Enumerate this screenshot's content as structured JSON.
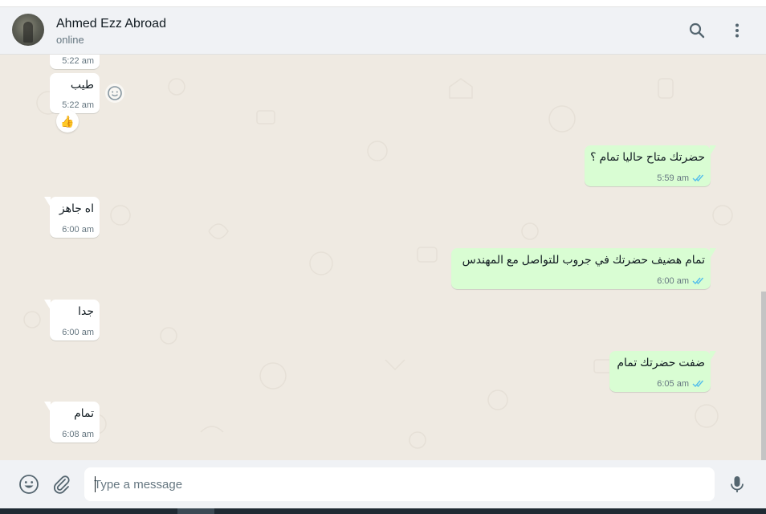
{
  "header": {
    "contact_name": "Ahmed Ezz Abroad",
    "status": "online",
    "icons": [
      "search-icon",
      "menu-dots-icon"
    ]
  },
  "messages": [
    {
      "dir": "in",
      "text": "",
      "time": "5:22 am"
    },
    {
      "dir": "in",
      "text": "طيب",
      "time": "5:22 am",
      "reaction": "👍"
    },
    {
      "dir": "out",
      "text": "حضرتك متاح حاليا تمام ؟",
      "time": "5:59 am",
      "status": "read"
    },
    {
      "dir": "in",
      "text": "اه جاهز",
      "time": "6:00 am"
    },
    {
      "dir": "out",
      "text": "تمام هضيف حضرتك في جروب للتواصل مع المهندس",
      "time": "6:00 am",
      "status": "read"
    },
    {
      "dir": "in",
      "text": "جدا",
      "time": "6:00 am"
    },
    {
      "dir": "out",
      "text": "ضفت حضرتك تمام",
      "time": "6:05 am",
      "status": "read"
    },
    {
      "dir": "in",
      "text": "تمام",
      "time": "6:08 am"
    }
  ],
  "footer": {
    "placeholder": "Type a message",
    "icons": [
      "emoji-icon",
      "attach-icon",
      "mic-icon"
    ]
  },
  "colors": {
    "chat_bg": "#efeae2",
    "outgoing_bubble": "#d9fdd3",
    "incoming_bubble": "#ffffff",
    "read_ticks": "#53bdeb",
    "header_bg": "#f0f2f5"
  }
}
